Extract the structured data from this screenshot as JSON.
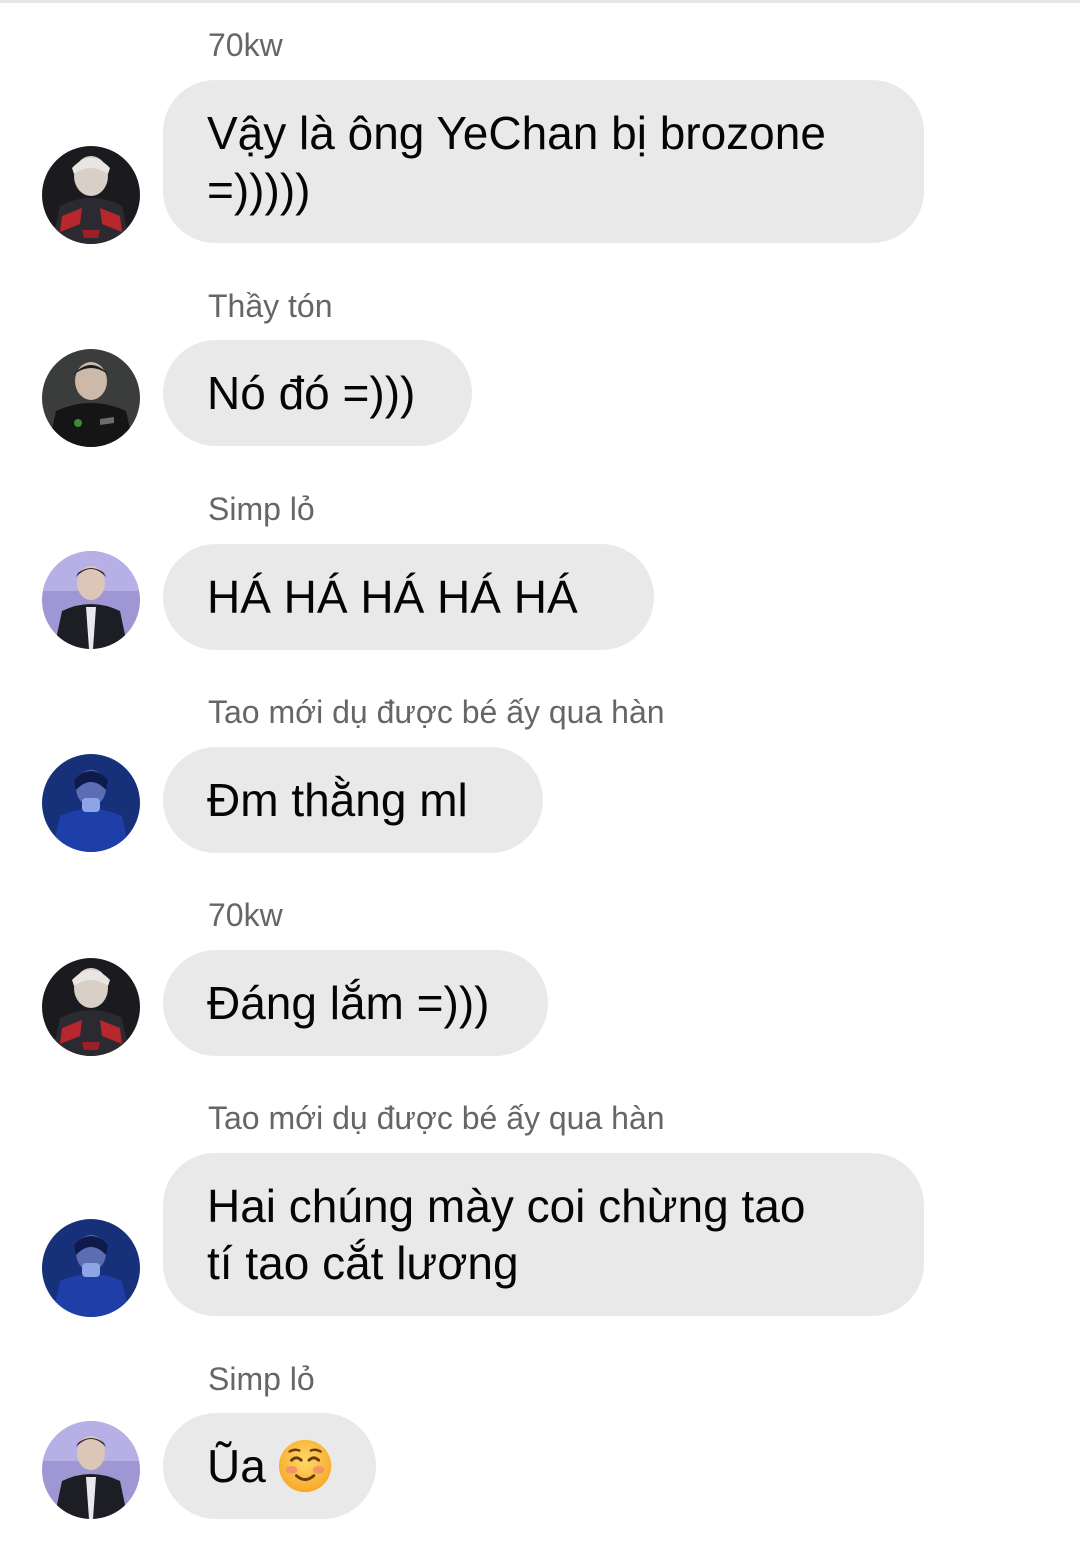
{
  "messages": [
    {
      "sender": "70kw",
      "text_lines": [
        "Vậy là ông YeChan bị brozone",
        "=)))))"
      ],
      "avatar": "avatar-red-jacket"
    },
    {
      "sender": "Thầy tón",
      "text_lines": [
        "Nó đó =)))"
      ],
      "avatar": "avatar-dark-jacket"
    },
    {
      "sender": "Simp lỏ",
      "text_lines": [
        "HÁ HÁ HÁ HÁ HÁ"
      ],
      "avatar": "avatar-suit"
    },
    {
      "sender": "Tao mới dụ được bé ấy qua hàn",
      "text_lines": [
        "Đm thằng ml"
      ],
      "avatar": "avatar-blue"
    },
    {
      "sender": "70kw",
      "text_lines": [
        "Đáng lắm =)))"
      ],
      "avatar": "avatar-red-jacket"
    },
    {
      "sender": "Tao mới dụ được bé ấy qua hàn",
      "text_lines": [
        "Hai chúng mày coi chừng tao",
        "tí tao cắt lương"
      ],
      "avatar": "avatar-blue"
    },
    {
      "sender": "Simp lỏ",
      "text_lines": [
        "Ũa"
      ],
      "emoji": "smiling-face-emoji",
      "avatar": "avatar-suit"
    }
  ],
  "colors": {
    "bubble": "#e9e9e9",
    "sender_text": "#666666",
    "message_text": "#050505",
    "background": "#ffffff"
  }
}
